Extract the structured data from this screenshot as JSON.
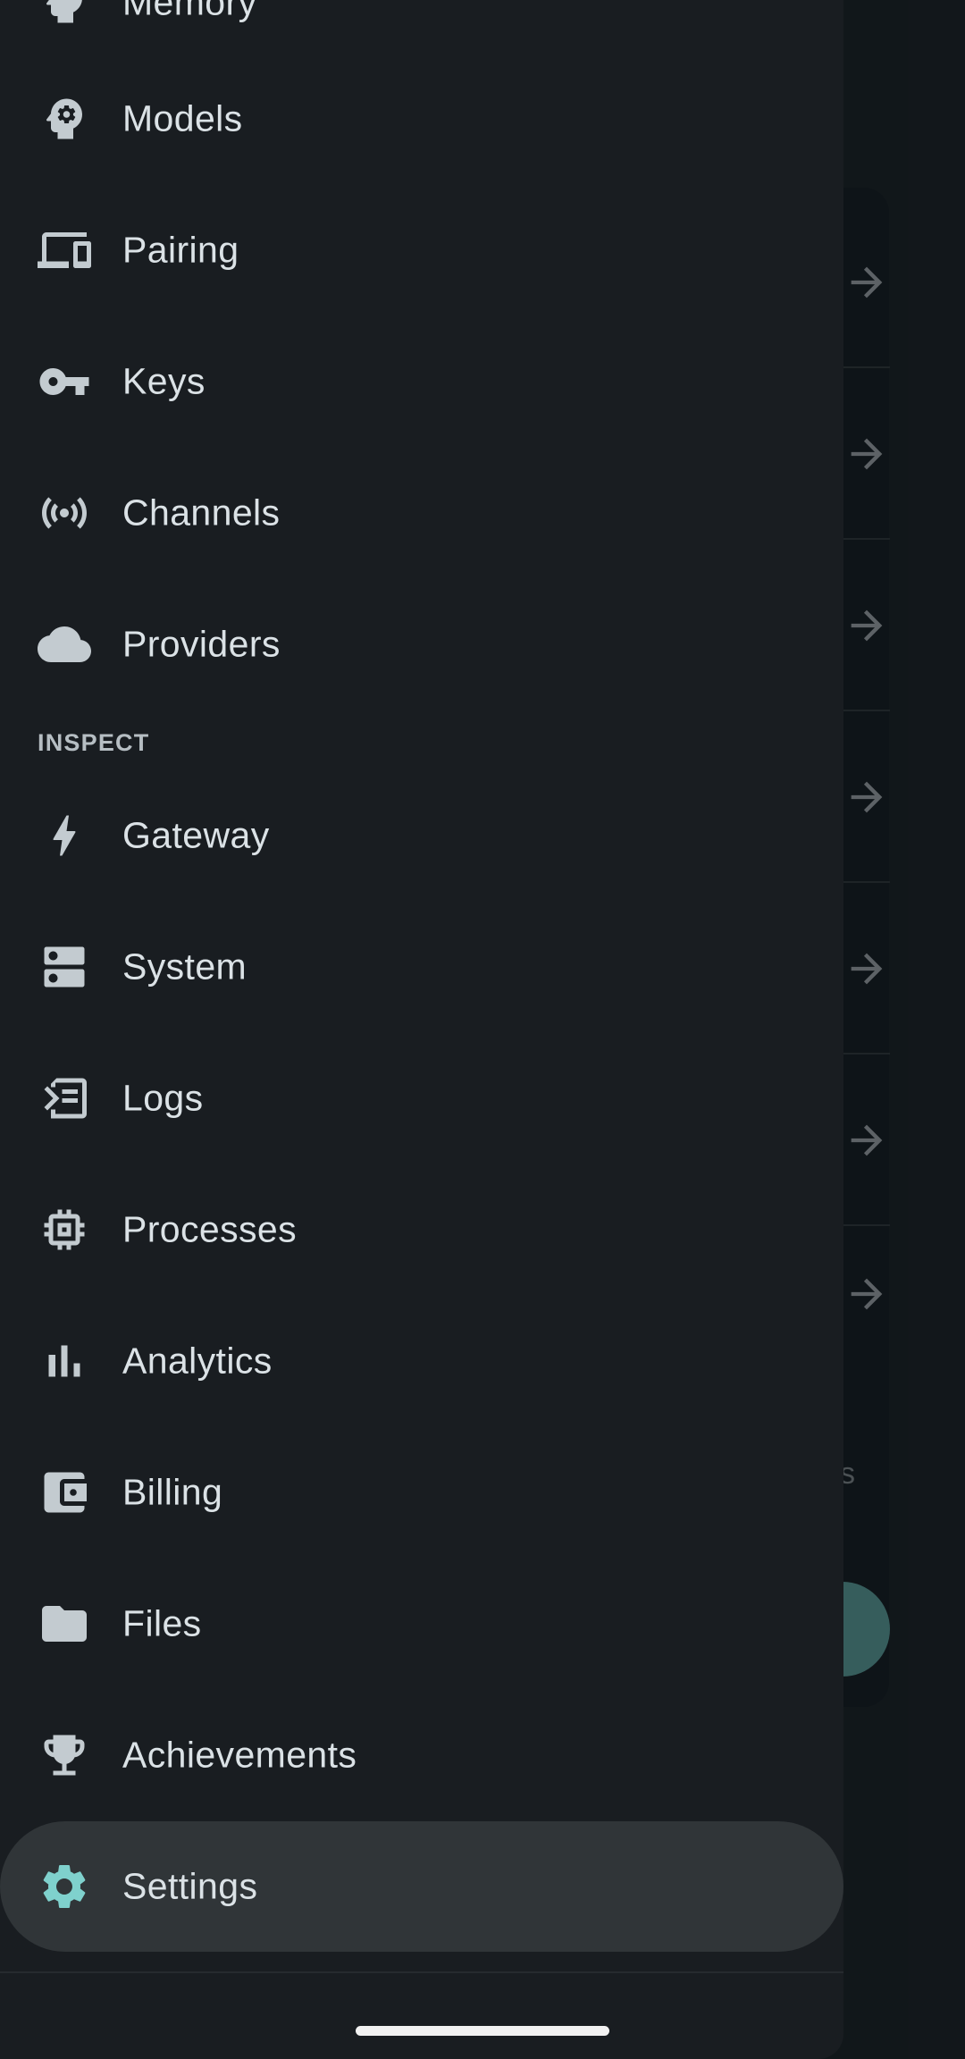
{
  "nav": {
    "top_items": [
      {
        "label": "Memory",
        "icon": "memory-icon"
      },
      {
        "label": "Models",
        "icon": "head-gear-icon"
      },
      {
        "label": "Pairing",
        "icon": "devices-icon"
      },
      {
        "label": "Keys",
        "icon": "key-icon"
      },
      {
        "label": "Channels",
        "icon": "broadcast-icon"
      },
      {
        "label": "Providers",
        "icon": "cloud-icon"
      }
    ],
    "inspect_header": "INSPECT",
    "inspect_items": [
      {
        "label": "Gateway",
        "icon": "bolt-icon"
      },
      {
        "label": "System",
        "icon": "dns-icon"
      },
      {
        "label": "Logs",
        "icon": "logs-icon"
      },
      {
        "label": "Processes",
        "icon": "chip-icon"
      },
      {
        "label": "Analytics",
        "icon": "bar-chart-icon"
      },
      {
        "label": "Billing",
        "icon": "wallet-icon"
      },
      {
        "label": "Files",
        "icon": "folder-icon"
      },
      {
        "label": "Achievements",
        "icon": "trophy-icon"
      },
      {
        "label": "Settings",
        "icon": "gear-icon",
        "selected": true
      }
    ]
  },
  "background": {
    "partial_text": "s"
  },
  "colors": {
    "drawer_bg": "#191d21",
    "selected_bg": "#303538",
    "accent": "#7fd1cd",
    "text": "#dbe2e6",
    "icon": "#c3cbd0"
  }
}
